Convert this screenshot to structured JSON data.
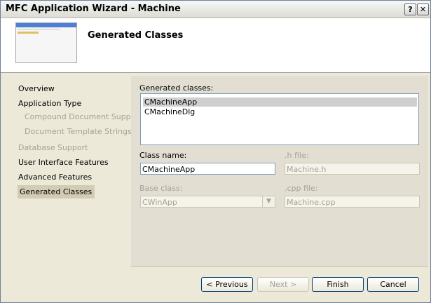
{
  "window": {
    "title": "MFC Application Wizard - Machine",
    "help_glyph": "?",
    "close_glyph": "✕"
  },
  "banner": {
    "title": "Generated Classes"
  },
  "nav": {
    "items": [
      {
        "label": "Overview",
        "state": "normal"
      },
      {
        "label": "Application Type",
        "state": "normal"
      },
      {
        "label": "Compound Document Support",
        "state": "disabled"
      },
      {
        "label": "Document Template Strings",
        "state": "disabled"
      },
      {
        "label": "Database Support",
        "state": "disabled"
      },
      {
        "label": "User Interface Features",
        "state": "normal"
      },
      {
        "label": "Advanced Features",
        "state": "normal"
      },
      {
        "label": "Generated Classes",
        "state": "selected"
      }
    ]
  },
  "form": {
    "generated_classes_label": "Generated classes:",
    "classes": [
      "CMachineApp",
      "CMachineDlg"
    ],
    "selected_class": "CMachineApp",
    "class_name_label": "Class name:",
    "class_name_value": "CMachineApp",
    "h_file_label": ".h file:",
    "h_file_value": "Machine.h",
    "base_class_label": "Base class:",
    "base_class_value": "CWinApp",
    "cpp_file_label": ".cpp file:",
    "cpp_file_value": "Machine.cpp"
  },
  "buttons": {
    "previous": "< Previous",
    "next": "Next >",
    "finish": "Finish",
    "cancel": "Cancel"
  }
}
